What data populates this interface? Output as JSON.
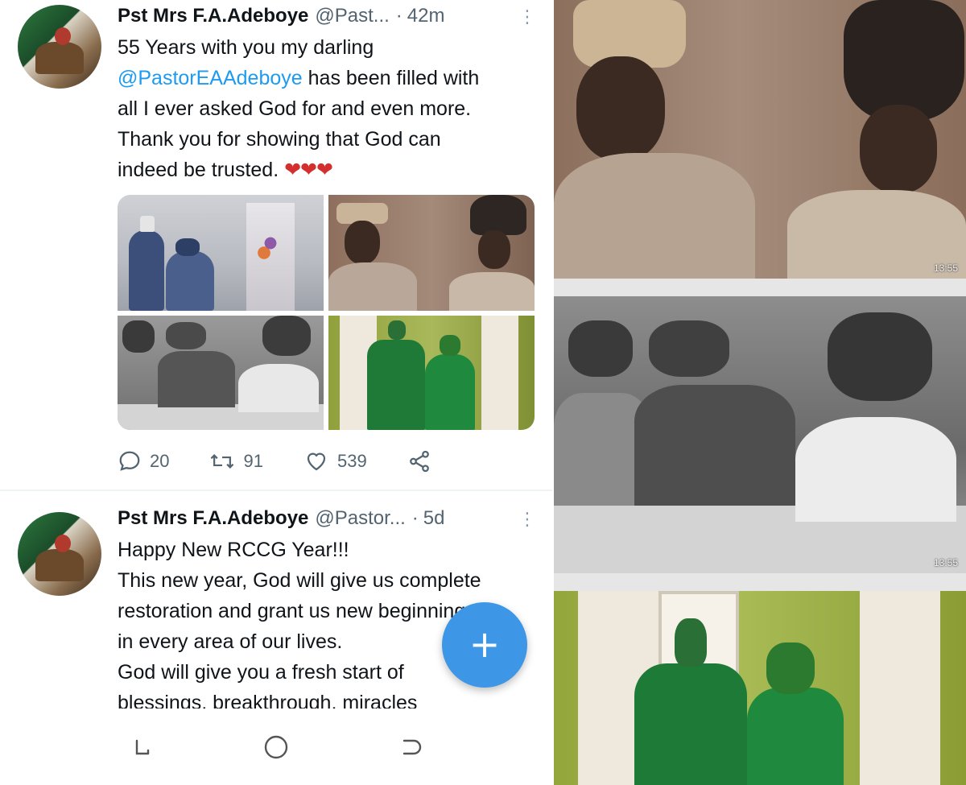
{
  "tweets": [
    {
      "name": "Pst Mrs F.A.Adeboye",
      "handle": "@Past...",
      "dot": "·",
      "time": "42m",
      "lines": [
        "55 Years with you my darling",
        "has been filled with",
        "all I ever asked God for and even more.",
        "Thank you for showing that God can",
        "indeed be trusted."
      ],
      "mention": "@PastorEAAdeboye",
      "hearts": "❤❤❤",
      "replies": "20",
      "retweets": "91",
      "likes": "539"
    },
    {
      "name": "Pst Mrs F.A.Adeboye",
      "handle": "@Pastor...",
      "dot": "·",
      "time": "5d",
      "lines": [
        "Happy New RCCG Year!!!",
        "This new year, God will give us complete",
        "restoration and grant us new beginnings",
        "in every area of our lives.",
        "God will give you a fresh start of",
        "blessings, breakthrough, miracles"
      ]
    }
  ],
  "fab_label": "+",
  "timestamps": [
    "13:55",
    "13:55"
  ],
  "colors": {
    "accent": "#1d9bf0",
    "fab": "#3d97e6",
    "heart": "#d32f2f"
  }
}
